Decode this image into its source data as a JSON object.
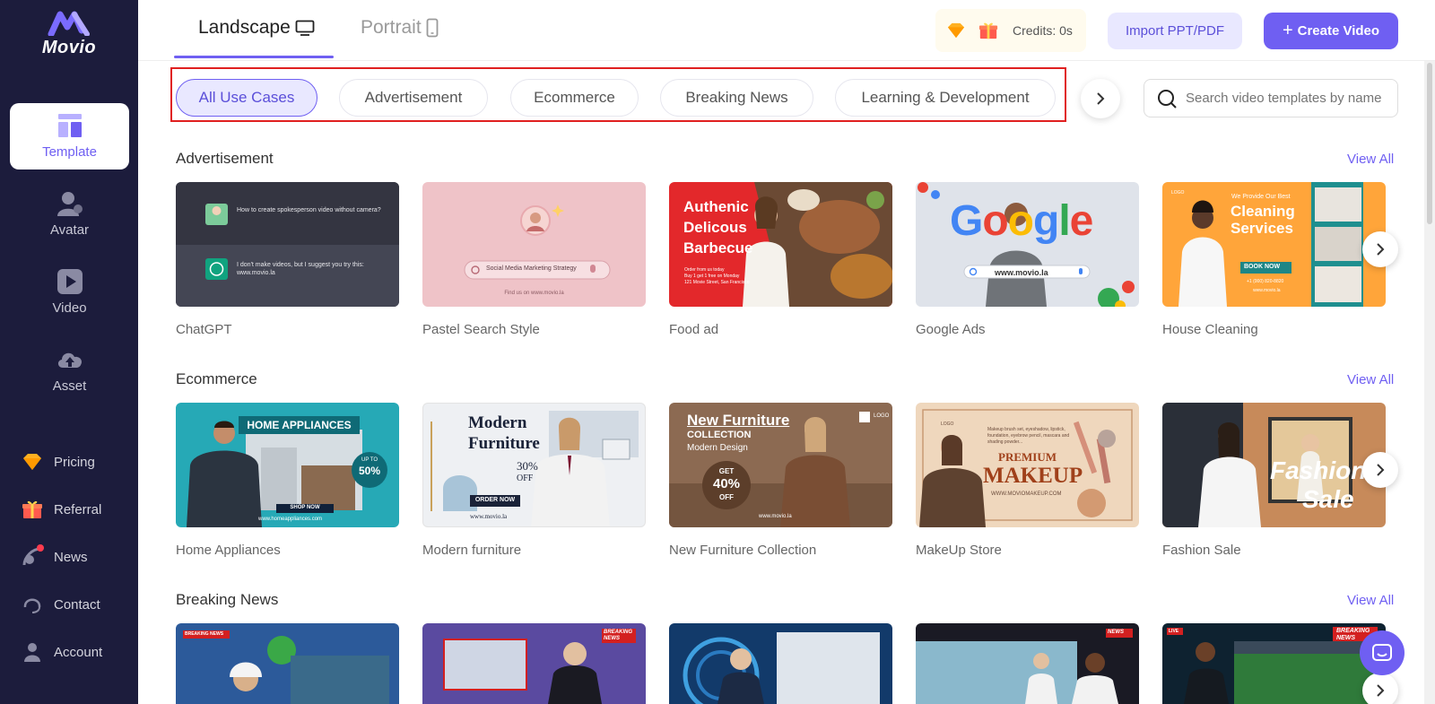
{
  "app": {
    "logo_text": "Movio"
  },
  "sidebar": {
    "main_items": [
      {
        "label": "Template",
        "icon": "template-icon",
        "active": true
      },
      {
        "label": "Avatar",
        "icon": "avatar-icon"
      },
      {
        "label": "Video",
        "icon": "video-play-icon"
      },
      {
        "label": "Asset",
        "icon": "cloud-upload-icon"
      }
    ],
    "bottom_items": [
      {
        "label": "Pricing",
        "icon": "diamond-icon"
      },
      {
        "label": "Referral",
        "icon": "gift-icon"
      },
      {
        "label": "News",
        "icon": "satellite-icon"
      },
      {
        "label": "Contact",
        "icon": "headset-icon"
      },
      {
        "label": "Account",
        "icon": "user-icon"
      }
    ]
  },
  "header": {
    "tabs": [
      {
        "label": "Landscape",
        "icon": "monitor-icon",
        "active": true
      },
      {
        "label": "Portrait",
        "icon": "phone-icon"
      }
    ],
    "credits": "Credits: 0s",
    "import_label": "Import PPT/PDF",
    "create_label": "Create Video",
    "create_plus": "+"
  },
  "filters": {
    "chips": [
      "All Use Cases",
      "Advertisement",
      "Ecommerce",
      "Breaking News",
      "Learning & Development"
    ],
    "active_chip": "All Use Cases",
    "search_placeholder": "Search video templates by name"
  },
  "sections": [
    {
      "title": "Advertisement",
      "view_all": "View All",
      "templates": [
        "ChatGPT",
        "Pastel Search Style",
        "Food ad",
        "Google Ads",
        "House Cleaning"
      ]
    },
    {
      "title": "Ecommerce",
      "view_all": "View All",
      "templates": [
        "Home Appliances",
        "Modern furniture",
        "New Furniture Collection",
        "MakeUp Store",
        "Fashion Sale"
      ]
    },
    {
      "title": "Breaking News",
      "view_all": "View All",
      "templates": [
        "",
        "",
        "",
        "",
        ""
      ]
    }
  ],
  "thumbnails": {
    "chatgpt": {
      "q": "How to create spokesperson video without camera?",
      "a": "I don't make videos, but I suggest you try this: www.movio.la"
    },
    "pastel": {
      "search": "Social Media Marketing Strategy",
      "footer": "Find us on www.movio.la"
    },
    "food": {
      "line1": "Authenic",
      "line2": "Delicous",
      "line3": "Barbecue",
      "small1": "Order from us today",
      "small2": "Buy 1 get 1 free on Monday",
      "small3": "121 Movie Street, San Francisco"
    },
    "google": {
      "word": "Google",
      "url": "www.movio.la"
    },
    "cleaning": {
      "logo": "LOGO",
      "tag": "We Provide Our Best",
      "title1": "Cleaning",
      "title2": "Services",
      "book": "BOOK NOW",
      "phone": "+1 (000) 820-8820",
      "site": "www.movio.la"
    },
    "appliances": {
      "title": "HOME APPLIANCES",
      "up": "UP TO",
      "pct": "50%",
      "shop": "SHOP NOW",
      "site": "www.homeappliances.com"
    },
    "modern": {
      "t1": "Modern",
      "t2": "Furniture",
      "pct": "30%",
      "off": "OFF",
      "order": "ORDER NOW",
      "site": "www.movio.la"
    },
    "newfurn": {
      "t1": "New Furniture",
      "t2": "COLLECTION",
      "t3": "Modern Design",
      "get": "GET",
      "pct": "40%",
      "off": "OFF",
      "logo": "LOGO",
      "site": "www.movio.la"
    },
    "makeup": {
      "logo": "LOGO",
      "t1": "PREMIUM",
      "t2": "MAKEUP",
      "site": "WWW.MOVIOMAKEUP.COM",
      "desc": "Makeup brush set, eyeshadow, lipstick, foundation, eyebrow pencil, mascara and shading powder..."
    },
    "fashion": {
      "t1": "Fashion",
      "t2": "Sale"
    },
    "news": {
      "bn": "BREAKING NEWS",
      "b1": "BREAKING",
      "b2": "NEWS",
      "n": "NEWS",
      "live": "LIVE"
    }
  },
  "colors": {
    "accent": "#6f5ff2",
    "sidebar_bg": "#1c1c3c",
    "highlight_border": "#e02020"
  }
}
